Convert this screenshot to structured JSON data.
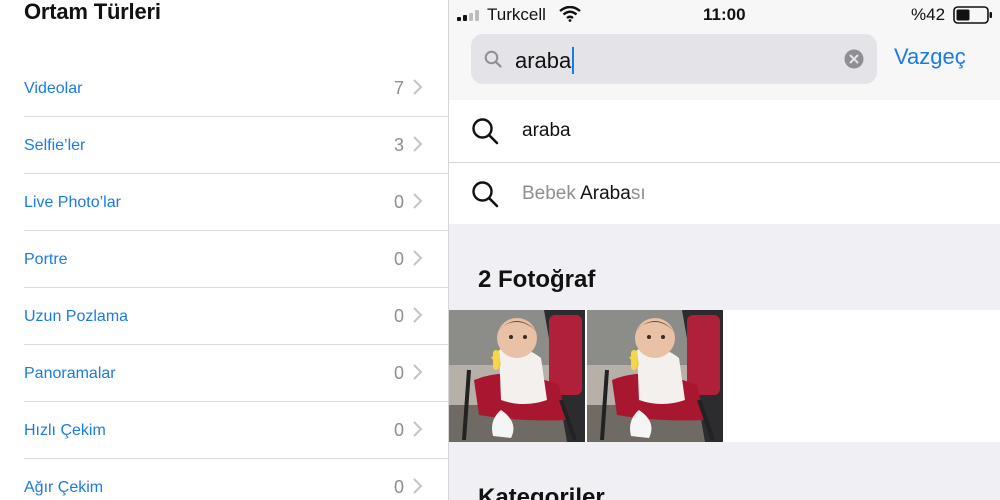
{
  "left_panel": {
    "title": "Ortam Türleri",
    "items": [
      {
        "label": "Videolar",
        "count": "7"
      },
      {
        "label": "Selfie’ler",
        "count": "3"
      },
      {
        "label": "Live Photo’lar",
        "count": "0"
      },
      {
        "label": "Portre",
        "count": "0"
      },
      {
        "label": "Uzun Pozlama",
        "count": "0"
      },
      {
        "label": "Panoramalar",
        "count": "0"
      },
      {
        "label": "Hızlı Çekim",
        "count": "0"
      },
      {
        "label": "Ağır Çekim",
        "count": "0"
      }
    ]
  },
  "status_bar": {
    "carrier": "Turkcell",
    "time": "11:00",
    "battery": "%42"
  },
  "search": {
    "value": "araba",
    "cancel_label": "Vazgeç"
  },
  "suggestions": [
    {
      "dim_prefix": "",
      "bold": "araba",
      "dim_suffix": ""
    },
    {
      "dim_prefix": "Bebek ",
      "bold": "Araba",
      "dim_suffix": "sı"
    }
  ],
  "results": {
    "photos_title": "2 Fotoğraf",
    "photos": [
      {
        "subject": "baby in stroller"
      },
      {
        "subject": "baby in stroller"
      }
    ],
    "categories_title": "Kategoriler"
  },
  "colors": {
    "accent": "#1a7be6",
    "secondary_text": "#8e8e93",
    "grouped_background": "#efeff4"
  }
}
